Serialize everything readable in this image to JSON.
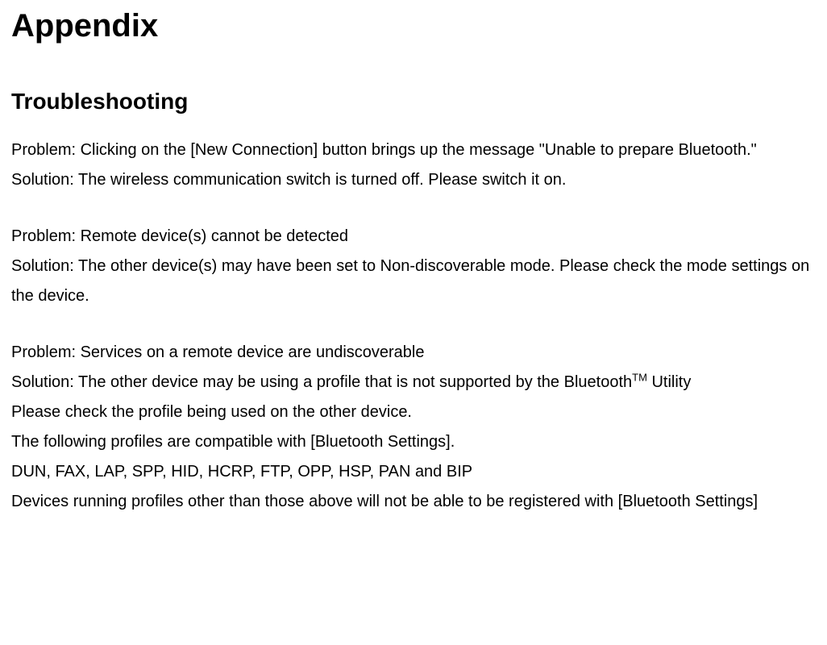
{
  "heading1": "Appendix",
  "heading2": "Troubleshooting",
  "block1": {
    "problem": "Problem: Clicking on the [New Connection] button brings up the message \"Unable to prepare Bluetooth.\"",
    "solution": "Solution: The wireless communication switch is turned off. Please switch it on."
  },
  "block2": {
    "problem": "Problem: Remote device(s) cannot be detected",
    "solution": "Solution: The other device(s) may have been set to Non-discoverable mode. Please check the mode settings on the device."
  },
  "block3": {
    "problem": "Problem: Services on a remote device are undiscoverable",
    "solution_pre": "Solution: The other device may be using a profile that is not supported by the Bluetooth",
    "tm": "TM",
    "solution_post": " Utility",
    "line2": "Please check the profile being used on the other device.",
    "line3": "The following profiles are compatible with [Bluetooth Settings].",
    "line4": "DUN, FAX, LAP, SPP, HID, HCRP, FTP, OPP, HSP, PAN and BIP",
    "line5": "Devices running profiles other than those above will not be able to be registered with [Bluetooth Settings]"
  }
}
